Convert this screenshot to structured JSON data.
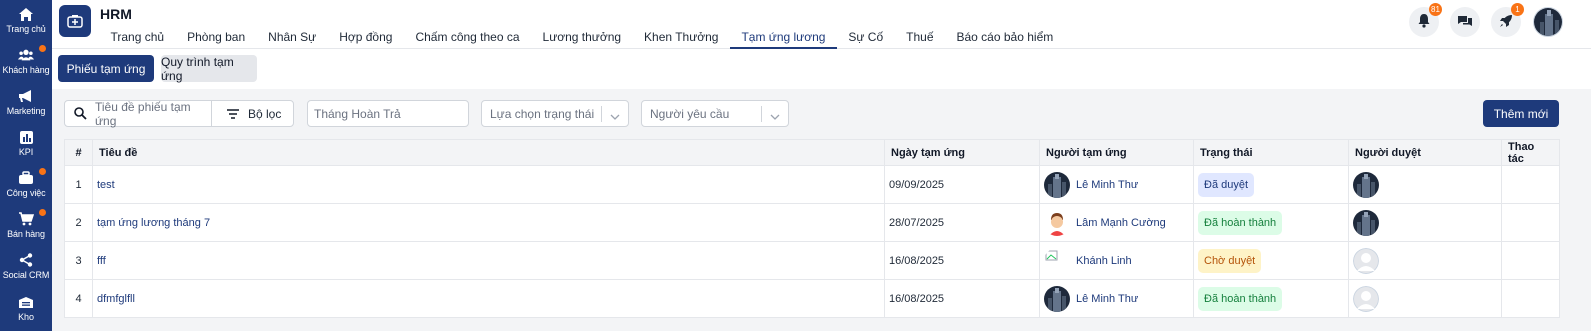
{
  "sidebar": {
    "items": [
      {
        "label": "Trang chủ",
        "icon": "home-icon",
        "dot": false
      },
      {
        "label": "Khách hàng",
        "icon": "users-icon",
        "dot": true
      },
      {
        "label": "Marketing",
        "icon": "megaphone-icon",
        "dot": false
      },
      {
        "label": "KPI",
        "icon": "chart-icon",
        "dot": false
      },
      {
        "label": "Công việc",
        "icon": "briefcase-icon",
        "dot": true
      },
      {
        "label": "Bán hàng",
        "icon": "cart-icon",
        "dot": true
      },
      {
        "label": "Social CRM",
        "icon": "share-icon",
        "dot": false
      },
      {
        "label": "Kho",
        "icon": "warehouse-icon",
        "dot": false
      }
    ]
  },
  "header": {
    "title": "HRM",
    "tabs": [
      "Trang chủ",
      "Phòng ban",
      "Nhân Sự",
      "Hợp đồng",
      "Chấm công theo ca",
      "Lương thưởng",
      "Khen Thưởng",
      "Tạm ứng lương",
      "Sự Cố",
      "Thuế",
      "Báo cáo bảo hiểm"
    ],
    "active_tab": "Tạm ứng lương",
    "notification_count": "81",
    "rocket_count": "1"
  },
  "subtabs": {
    "primary": "Phiếu tạm ứng",
    "secondary": "Quy trình tạm ứng"
  },
  "filters": {
    "search_placeholder": "Tiêu đề phiếu tạm ứng",
    "filter_label": "Bộ lọc",
    "month_placeholder": "Tháng Hoàn Trả",
    "status_placeholder": "Lựa chọn trạng thái",
    "requester_placeholder": "Người yêu cầu",
    "add_label": "Thêm mới"
  },
  "table": {
    "headers": [
      "#",
      "Tiêu đề",
      "Ngày tạm ứng",
      "Người tạm ứng",
      "Trạng thái",
      "Người duyệt",
      "Thao tác"
    ],
    "rows": [
      {
        "idx": "1",
        "title": "test",
        "date": "09/09/2025",
        "person": "Lê Minh Thư",
        "status": "Đã duyệt"
      },
      {
        "idx": "2",
        "title": "tạm ứng lương tháng 7",
        "date": "28/07/2025",
        "person": "Lâm Mạnh Cường",
        "status": "Đã hoàn thành"
      },
      {
        "idx": "3",
        "title": "fff",
        "date": "16/08/2025",
        "person": "Khánh Linh",
        "status": "Chờ duyệt"
      },
      {
        "idx": "4",
        "title": "dfmfglfll",
        "date": "16/08/2025",
        "person": "Lê Minh Thư",
        "status": "Đã hoàn thành"
      }
    ]
  },
  "colors": {
    "brand": "#1e3a7b",
    "accent": "#f97316"
  }
}
